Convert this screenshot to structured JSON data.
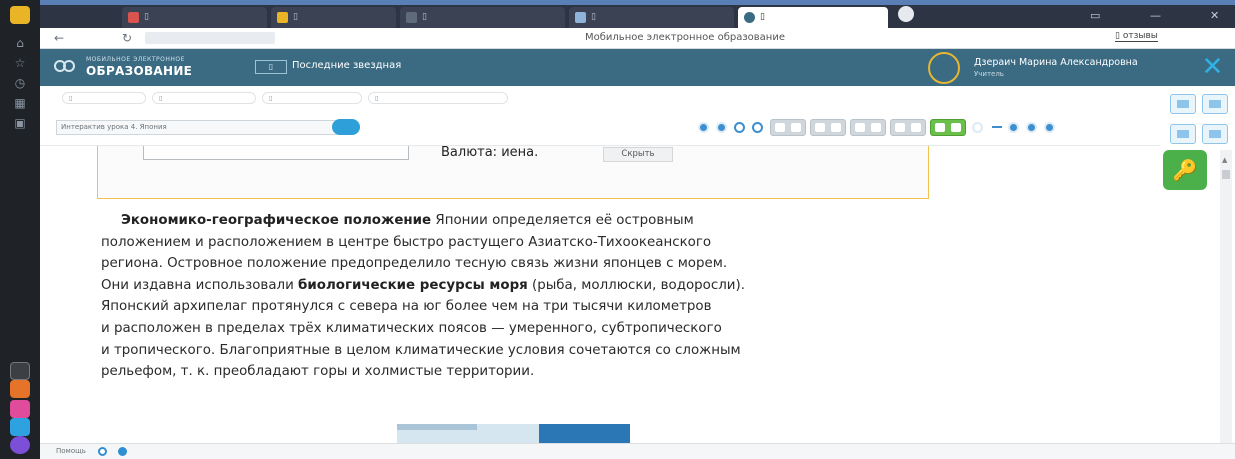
{
  "browser": {
    "tabs": [
      {
        "title": "▯"
      },
      {
        "title": "▯"
      },
      {
        "title": "▯"
      },
      {
        "title": "▯"
      },
      {
        "title": "▯",
        "active": true
      }
    ],
    "window_controls": [
      "▭",
      "—",
      "✕"
    ],
    "address_bar": {
      "back": "←",
      "reload": "↻",
      "page_title": "Мобильное электронное образование",
      "reviews": "▯ отзывы"
    }
  },
  "app": {
    "logo_small": "МОБИЛЬНОЕ ЭЛЕКТРОННОЕ",
    "logo_big": "ОБРАЗОВАНИЕ",
    "recent_badge": "▯",
    "recent_label": "Последние звездная",
    "user_name": "Дзераич Марина Александровна",
    "user_role": "Учитель",
    "close": "✕"
  },
  "breadcrumbs": [
    "▯",
    "▯",
    "▯",
    "▯"
  ],
  "toolbar": {
    "lesson_select": "Интерактив урока 4. Япония"
  },
  "answer": {
    "text": "Валюта: иена.",
    "hide_button": "Скрыть"
  },
  "paragraph": {
    "l1_bold": "Экономико-географическое положение",
    "l1_rest": " Японии определяется её островным",
    "l2": "положением и расположением в центре быстро растущего Азиатско-Тихоокеанского",
    "l3": "региона. Островное положение предопределило тесную связь жизни японцев с морем.",
    "l4_a": "Они издавна использовали ",
    "l4_bold": "биологические ресурсы моря",
    "l4_rest": " (рыба, моллюски, водоросли).",
    "l5": "Японский архипелаг протянулся с севера на юг более чем на три тысячи километров",
    "l6": "и расположен в пределах трёх климатических поясов — умеренного, субтропического",
    "l7": "и тропического. Благоприятные в целом климатические условия сочетаются со сложным",
    "l8": "рельефом, т. к. преобладают горы и холмистые территории."
  },
  "right_panel": {
    "key_icon": "🔑"
  },
  "status": {
    "text": "Помощь"
  },
  "colors": {
    "header": "#3b6b83",
    "accent_blue": "#2f9fd9",
    "green": "#4cb04a",
    "answer_border": "#f2c14e"
  }
}
